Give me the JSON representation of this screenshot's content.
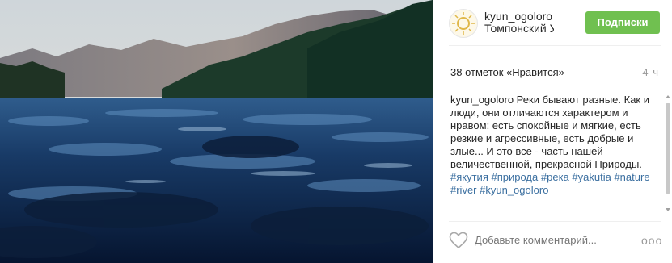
{
  "post": {
    "username": "kyun_ogoloro",
    "location": "Томпонский Ул...",
    "follow_label": "Подписки",
    "likes_text": "38 отметок «Нравится»",
    "time_ago": "4 ч",
    "caption": {
      "username": "kyun_ogoloro",
      "text": " Реки бывают разные. Как и люди, они отличаются характером и нравом: есть спокойные и мягкие, есть резкие и агрессивные, есть добрые и злые... И это все - часть нашей величественной, прекрасной Природы. ",
      "hashtags": [
        "#якутия",
        "#природа",
        "#река",
        "#yakutia",
        "#nature",
        "#river",
        "#kyun_ogoloro"
      ]
    },
    "comment_placeholder": "Добавьте комментарий...",
    "more_label": "ooo"
  },
  "colors": {
    "follow_button": "#70c050",
    "hashtag": "#3b6fa0",
    "muted": "#999999"
  },
  "icons": {
    "like": "heart-outline-icon",
    "more": "ellipsis-icon"
  }
}
